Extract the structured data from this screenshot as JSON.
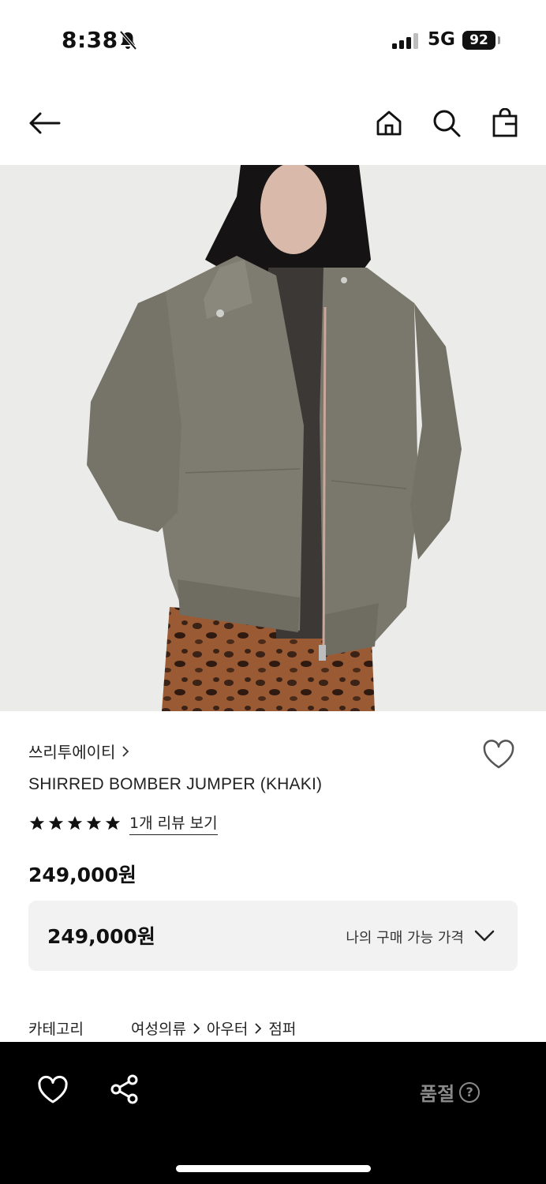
{
  "status_bar": {
    "time": "8:38",
    "network": "5G",
    "battery": "92"
  },
  "nav": {
    "back_icon": "arrow-left-icon",
    "home_icon": "home-icon",
    "search_icon": "search-icon",
    "bag_icon": "shopping-bag-icon"
  },
  "product": {
    "brand": "쓰리투에이티",
    "title": "SHIRRED BOMBER JUMPER (KHAKI)",
    "rating": 5,
    "review_link": "1개 리뷰 보기",
    "price": "249,000원",
    "my_price": {
      "value": "249,000원",
      "label": "나의 구매 가능 가격"
    },
    "category": {
      "label": "카테고리",
      "path": [
        "여성의류",
        "아우터",
        "점퍼"
      ]
    }
  },
  "bottom_bar": {
    "soldout_label": "품절",
    "help": "?"
  },
  "colors": {
    "jacket": "#7d7b70",
    "background": "#e9e9e8",
    "bottom_bar": "#000000"
  }
}
